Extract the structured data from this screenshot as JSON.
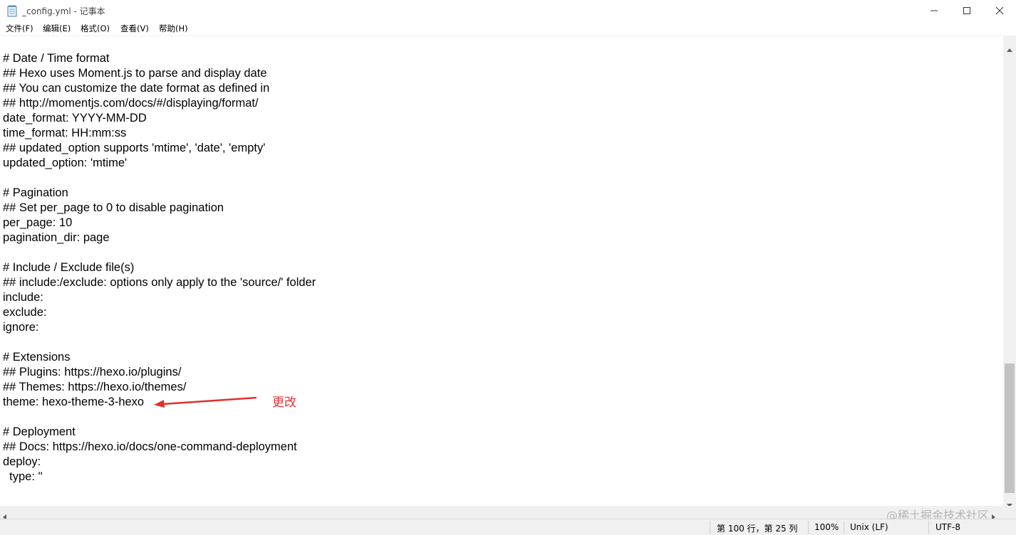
{
  "window": {
    "title": "_config.yml - 记事本",
    "minimize_icon": "minimize-icon",
    "maximize_icon": "maximize-icon",
    "close_icon": "close-icon"
  },
  "menu": {
    "items": [
      {
        "label": "文件(F)"
      },
      {
        "label": "编辑(E)"
      },
      {
        "label": "格式(O)"
      },
      {
        "label": "查看(V)"
      },
      {
        "label": "帮助(H)"
      }
    ]
  },
  "editor": {
    "lines": [
      "# Date / Time format",
      "## Hexo uses Moment.js to parse and display date",
      "## You can customize the date format as defined in",
      "## http://momentjs.com/docs/#/displaying/format/",
      "date_format: YYYY-MM-DD",
      "time_format: HH:mm:ss",
      "## updated_option supports 'mtime', 'date', 'empty'",
      "updated_option: 'mtime'",
      "",
      "# Pagination",
      "## Set per_page to 0 to disable pagination",
      "per_page: 10",
      "pagination_dir: page",
      "",
      "# Include / Exclude file(s)",
      "## include:/exclude: options only apply to the 'source/' folder",
      "include:",
      "exclude:",
      "ignore:",
      "",
      "# Extensions",
      "## Plugins: https://hexo.io/plugins/",
      "## Themes: https://hexo.io/themes/",
      "theme: hexo-theme-3-hexo",
      "",
      "# Deployment",
      "## Docs: https://hexo.io/docs/one-command-deployment",
      "deploy:",
      "  type: ''"
    ]
  },
  "annotation": {
    "text": "更改",
    "color": "#e03030"
  },
  "status": {
    "position": "第 100 行，第 25 列",
    "zoom": "100%",
    "line_ending": "Unix (LF)",
    "encoding": "UTF-8"
  },
  "watermark": {
    "text": "@稀土掘金技术社区"
  }
}
